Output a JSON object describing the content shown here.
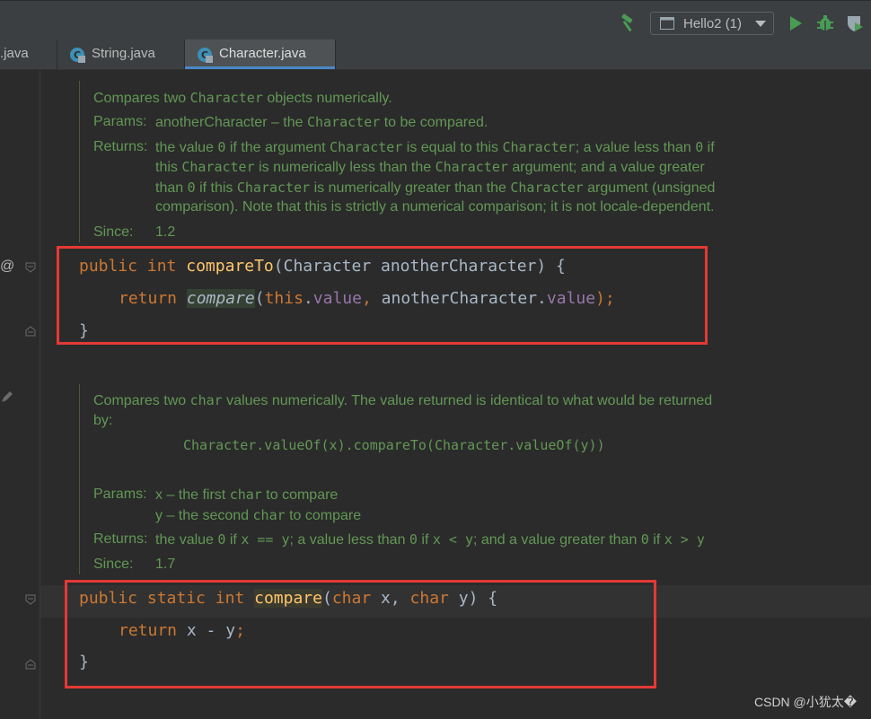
{
  "toolbar": {
    "run_config_label": "Hello2 (1)",
    "icons": [
      "hammer-icon",
      "run-icon",
      "debug-icon",
      "coverage-icon"
    ]
  },
  "tabs": [
    {
      "label": ".java",
      "active": false
    },
    {
      "label": "String.java",
      "active": false
    },
    {
      "label": "Character.java",
      "active": true
    }
  ],
  "doc1": {
    "summary_pre": "Compares two ",
    "summary_code": "Character",
    "summary_post": " objects numerically.",
    "params_label": "Params:",
    "params_text_pre": "anotherCharacter – the ",
    "params_code": "Character",
    "params_text_post": " to be compared.",
    "returns_label": "Returns:",
    "returns_lines": [
      [
        "the value ",
        "0",
        " if the argument ",
        "Character",
        " is equal to this ",
        "Character",
        "; a value less than ",
        "0",
        " if"
      ],
      [
        "this ",
        "Character",
        " is numerically less than the ",
        "Character",
        " argument; and a value greater"
      ],
      [
        "than ",
        "0",
        " if this ",
        "Character",
        " is numerically greater than the ",
        "Character",
        " argument (unsigned"
      ],
      [
        "comparison). Note that this is strictly a numerical comparison; it is not locale-dependent."
      ]
    ],
    "since_label": "Since:",
    "since_value": "1.2"
  },
  "code1": {
    "line1": {
      "kw1": "public",
      "kw2": "int",
      "fn": "compareTo",
      "rest": "(Character anotherCharacter) {"
    },
    "line2": {
      "kw": "return",
      "call": "compare",
      "p1": "(",
      "this": "this",
      "dot1": ".",
      "f1": "value",
      "comma": ", anotherCharacter.",
      "f2": "value",
      "end": ");"
    },
    "line3": "}"
  },
  "doc2": {
    "summary_pre": "Compares two ",
    "summary_code": "char",
    "summary_post": " values numerically. The value returned is identical to what would be returned",
    "summary_line2": "by:",
    "example": "Character.valueOf(x).compareTo(Character.valueOf(y))",
    "params_label": "Params:",
    "param1_pre": "x – the first ",
    "param1_code": "char",
    "param1_post": " to compare",
    "param2_pre": "y – the second ",
    "param2_code": "char",
    "param2_post": " to compare",
    "returns_label": "Returns:",
    "returns_parts": [
      "the value ",
      "0",
      " if ",
      "x == y",
      "; a value less than ",
      "0",
      " if ",
      "x < y",
      "; and a value greater than ",
      "0",
      " if ",
      "x > y"
    ],
    "since_label": "Since:",
    "since_value": "1.7"
  },
  "code2": {
    "line1": {
      "kw1": "public",
      "kw2": "static",
      "kw3": "int",
      "fn": "compare",
      "p_open": "(",
      "t1": "char",
      "a1": " x, ",
      "t2": "char",
      "a2": " y) {"
    },
    "line2": {
      "kw": "return",
      "expr": " x - y",
      "semi": ";"
    },
    "line3": "}"
  },
  "gutter": {
    "override_marker": "@"
  },
  "watermark": "CSDN @小犹太�",
  "colors": {
    "highlight_box": "#e53935",
    "doc_text": "#629755",
    "keyword": "#cc7832",
    "method": "#ffc66d",
    "field": "#9876aa"
  }
}
